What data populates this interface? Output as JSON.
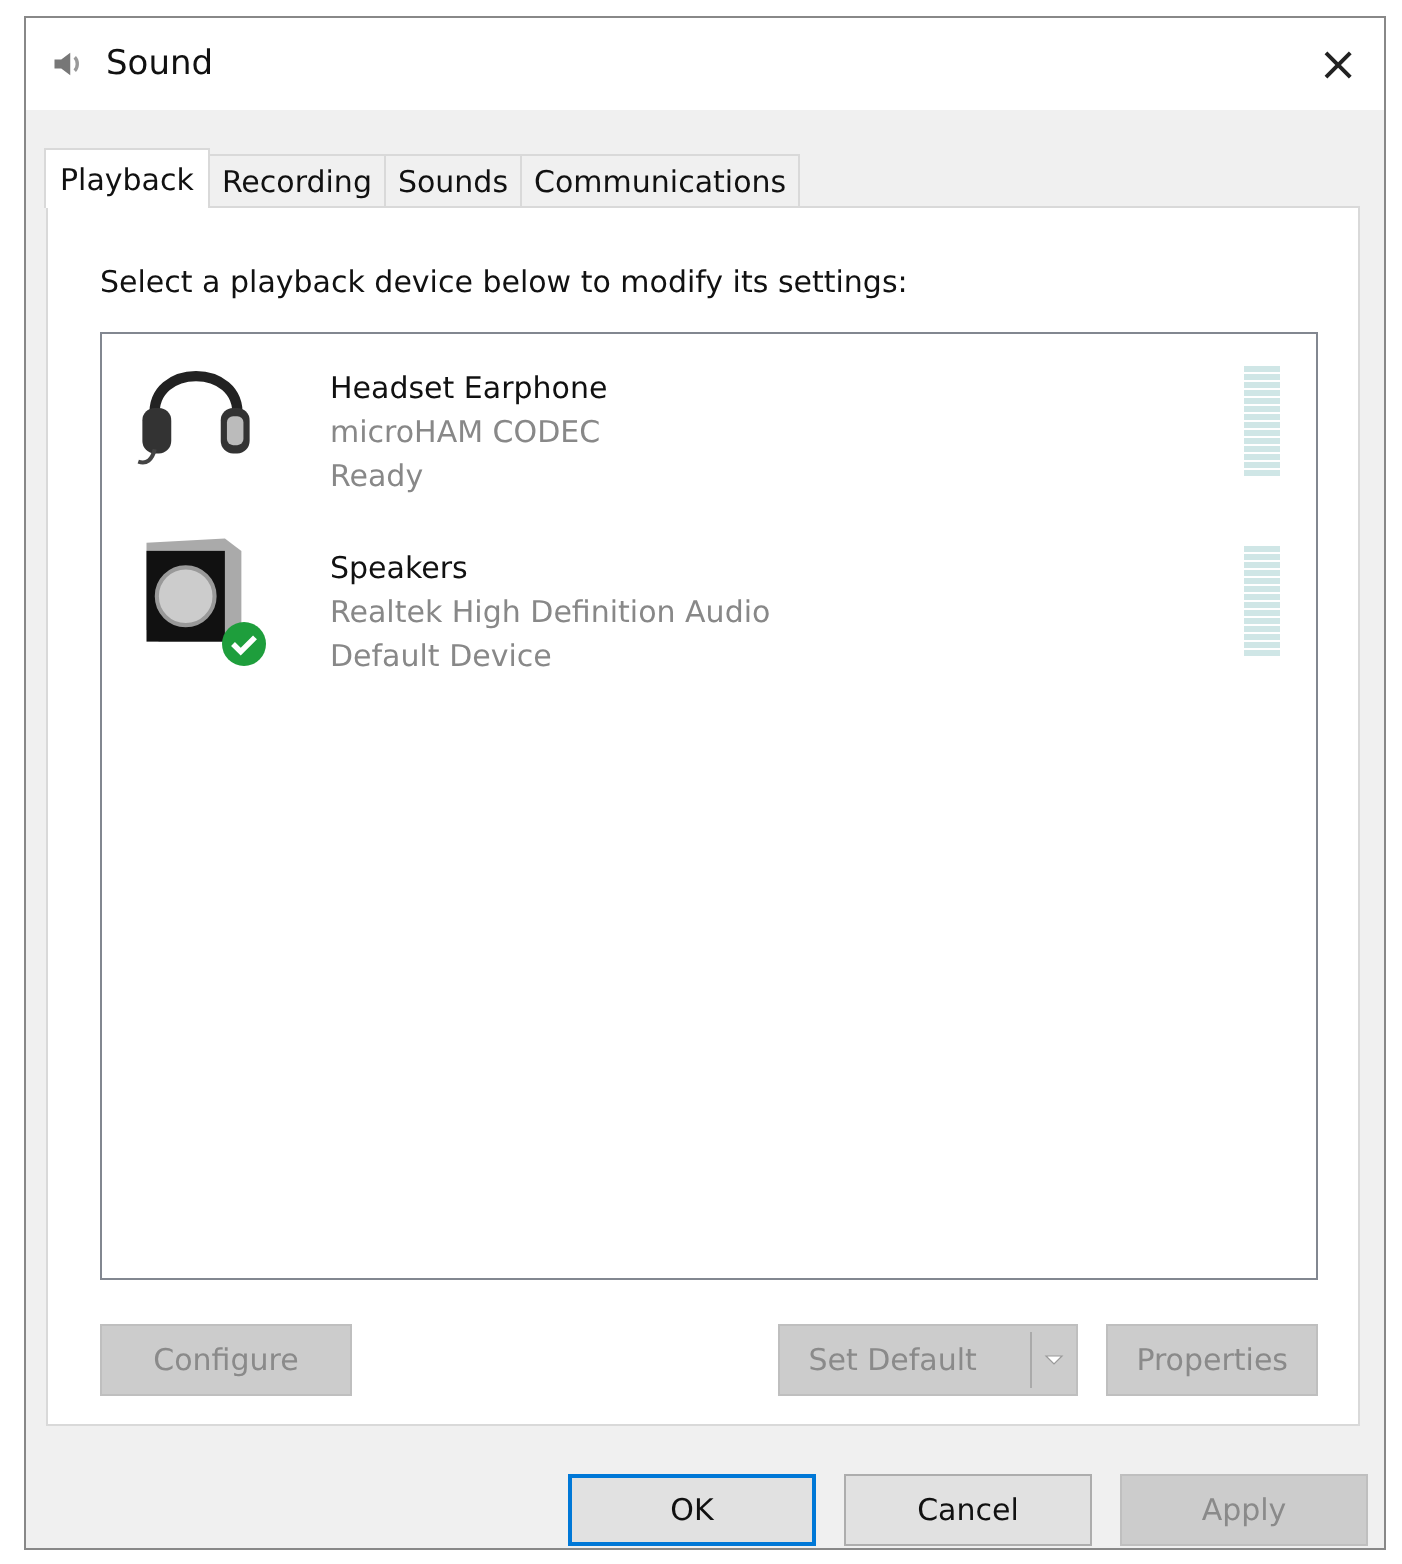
{
  "window": {
    "title": "Sound",
    "close": "×"
  },
  "tabs": [
    {
      "label": "Playback",
      "selected": true
    },
    {
      "label": "Recording",
      "selected": false
    },
    {
      "label": "Sounds",
      "selected": false
    },
    {
      "label": "Communications",
      "selected": false
    }
  ],
  "instruction": "Select a playback device below to modify its settings:",
  "devices": [
    {
      "kind": "headset",
      "name": "Headset Earphone",
      "driver": "microHAM CODEC",
      "status": "Ready",
      "default": false
    },
    {
      "kind": "speaker",
      "name": "Speakers",
      "driver": "Realtek High Definition Audio",
      "status": "Default Device",
      "default": true
    }
  ],
  "device_buttons": [
    {
      "kind": "plain",
      "label": "Configure",
      "disabled": true
    },
    {
      "kind": "split",
      "label": "Set Default",
      "disabled": true
    },
    {
      "kind": "plain",
      "label": "Properties",
      "disabled": true
    }
  ],
  "dialog_buttons": [
    {
      "label": "OK",
      "disabled": false,
      "default": true
    },
    {
      "label": "Cancel",
      "disabled": false,
      "default": false
    },
    {
      "label": "Apply",
      "disabled": true,
      "default": false
    }
  ]
}
